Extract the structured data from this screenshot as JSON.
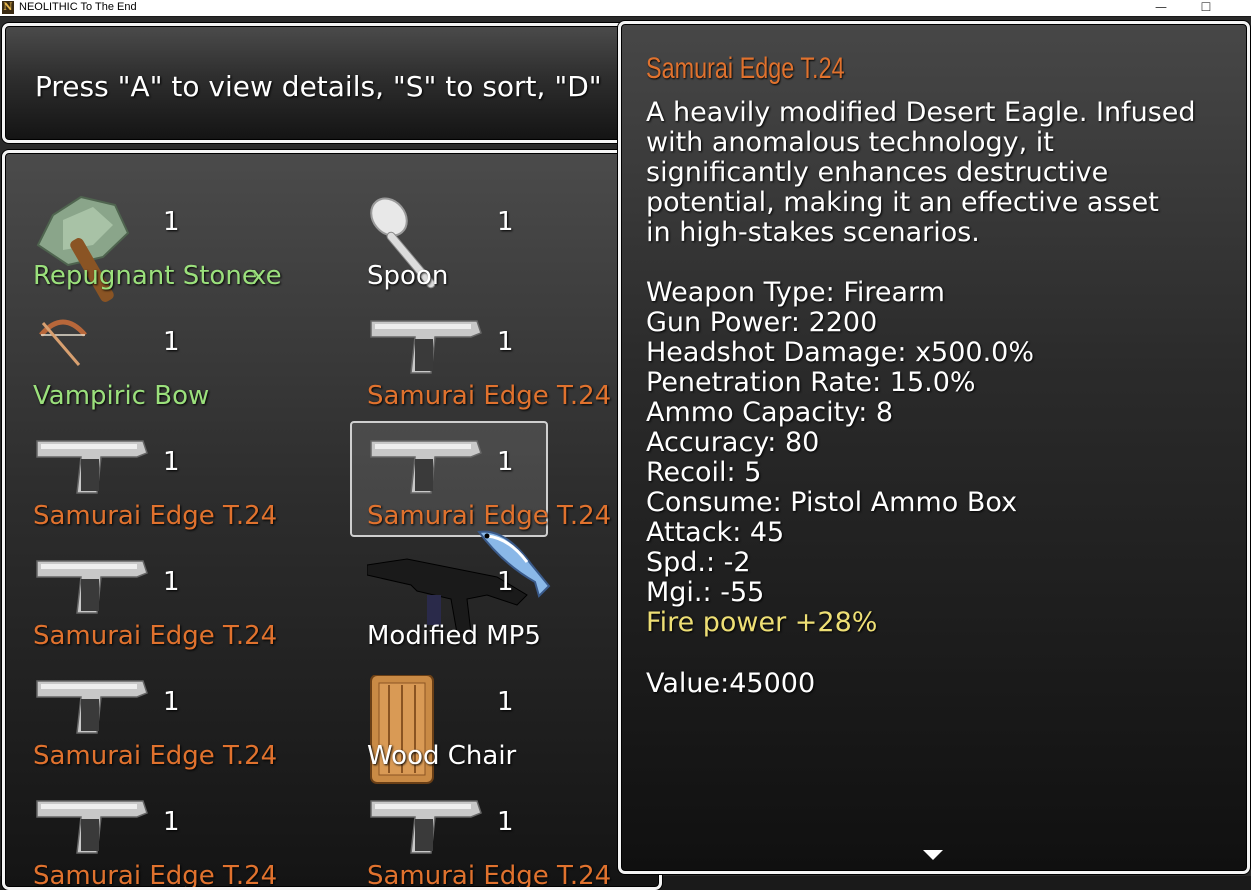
{
  "window": {
    "title": "NEOLITHIC To The End",
    "icon_letter": "N",
    "minimize": "—",
    "maximize": "☐"
  },
  "help": {
    "text": "Press \"A\" to view details, \"S\" to sort, \"D\""
  },
  "colors": {
    "rare": "#9be07c",
    "legendary": "#e0722e",
    "common": "#ffffff",
    "bonus": "#eedf75"
  },
  "items": [
    {
      "name": "Repugnant Stone",
      "suffix": "xe",
      "count": "1",
      "icon": "stone-axe-icon",
      "tier": "rare"
    },
    {
      "name": "Spoon",
      "count": "1",
      "icon": "spoon-icon",
      "tier": "common"
    },
    {
      "name": "Vampiric Bow",
      "count": "1",
      "icon": "bow-icon",
      "tier": "rare"
    },
    {
      "name": "Samurai Edge T.24",
      "count": "1",
      "icon": "pistol-icon",
      "tier": "legendary"
    },
    {
      "name": "Samurai Edge T.24",
      "count": "1",
      "icon": "pistol-icon",
      "tier": "legendary"
    },
    {
      "name": "Samurai Edge T.24",
      "count": "1",
      "icon": "pistol-icon",
      "tier": "legendary",
      "selected": true
    },
    {
      "name": "Samurai Edge T.24",
      "count": "1",
      "icon": "pistol-icon",
      "tier": "legendary"
    },
    {
      "name": "Modified MP5",
      "count": "1",
      "icon": "smg-icon",
      "tier": "common"
    },
    {
      "name": "Samurai Edge T.24",
      "count": "1",
      "icon": "pistol-icon",
      "tier": "legendary"
    },
    {
      "name": "Wood Chair",
      "count": "1",
      "icon": "chair-icon",
      "tier": "common"
    },
    {
      "name": "Samurai Edge T.24",
      "count": "1",
      "icon": "pistol-icon",
      "tier": "legendary"
    },
    {
      "name": "Samurai Edge T.24",
      "count": "1",
      "icon": "pistol-icon",
      "tier": "legendary"
    }
  ],
  "detail": {
    "title": "Samurai Edge T.24",
    "description": [
      "A heavily modified Desert Eagle. Infused",
      "with anomalous technology,  it",
      "significantly enhances destructive",
      "potential, making it an effective asset",
      "in high-stakes scenarios."
    ],
    "stats": [
      "Weapon Type: Firearm",
      "Gun Power: 2200",
      "Headshot Damage: x500.0%",
      "Penetration Rate: 15.0%",
      "Ammo Capacity: 8",
      "Accuracy: 80",
      "Recoil: 5",
      "Consume: Pistol Ammo Box",
      "Attack: 45",
      "Spd.: -2",
      "Mgi.: -55"
    ],
    "bonus": "Fire power +28%",
    "value": "Value:45000"
  }
}
